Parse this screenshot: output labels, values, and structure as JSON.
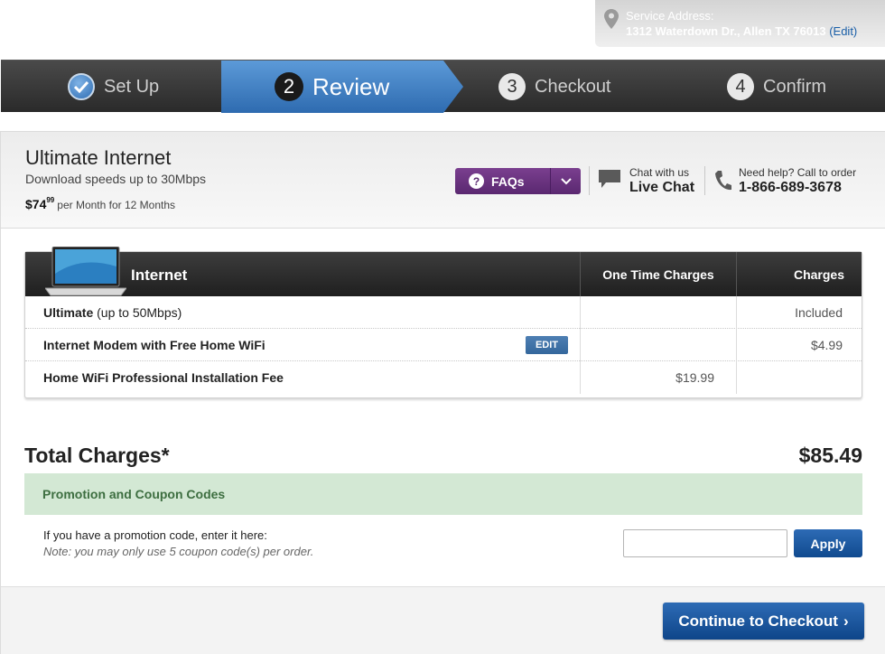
{
  "service_address": {
    "label": "Service Address:",
    "address": "1312 Waterdown Dr., Allen TX 76013",
    "edit_label": "(Edit)"
  },
  "steps": [
    {
      "number": "",
      "label": "Set Up",
      "state": "done"
    },
    {
      "number": "2",
      "label": "Review",
      "state": "active"
    },
    {
      "number": "3",
      "label": "Checkout",
      "state": "pending"
    },
    {
      "number": "4",
      "label": "Confirm",
      "state": "pending"
    }
  ],
  "product": {
    "title": "Ultimate Internet",
    "subtitle": "Download speeds up to 30Mbps",
    "price_main": "$74",
    "price_cents": "99",
    "price_term": "per Month for 12 Months"
  },
  "faqs": {
    "label": "FAQs",
    "icon": "question-icon"
  },
  "chat": {
    "line1": "Chat with us",
    "line2": "Live Chat"
  },
  "help": {
    "line1": "Need help? Call to order",
    "line2": "1-866-689-3678"
  },
  "table": {
    "section": "Internet",
    "col_one_time": "One Time Charges",
    "col_charges": "Charges",
    "rows": [
      {
        "name_bold": "Ultimate",
        "name_plain": " (up to 50Mbps)",
        "one_time": "",
        "charges": "Included"
      },
      {
        "name_bold": "Internet Modem with Free Home WiFi",
        "name_plain": "",
        "one_time": "",
        "charges": "$4.99",
        "edit": "EDIT"
      },
      {
        "name_bold": "Home WiFi Professional Installation Fee",
        "name_plain": "",
        "one_time": "$19.99",
        "charges": ""
      }
    ]
  },
  "totals": {
    "label": "Total Charges*",
    "value": "$85.49"
  },
  "promo": {
    "header": "Promotion and Coupon Codes",
    "line1": "If you have a promotion code, enter it here:",
    "line2": "Note: you may only use 5 coupon code(s) per order.",
    "input_value": "",
    "apply_label": "Apply"
  },
  "footer": {
    "continue_label": "Continue to Checkout"
  },
  "colors": {
    "accent_blue": "#2e6bb0",
    "faq_purple": "#5a2870",
    "promo_green": "#d3e8d4"
  }
}
